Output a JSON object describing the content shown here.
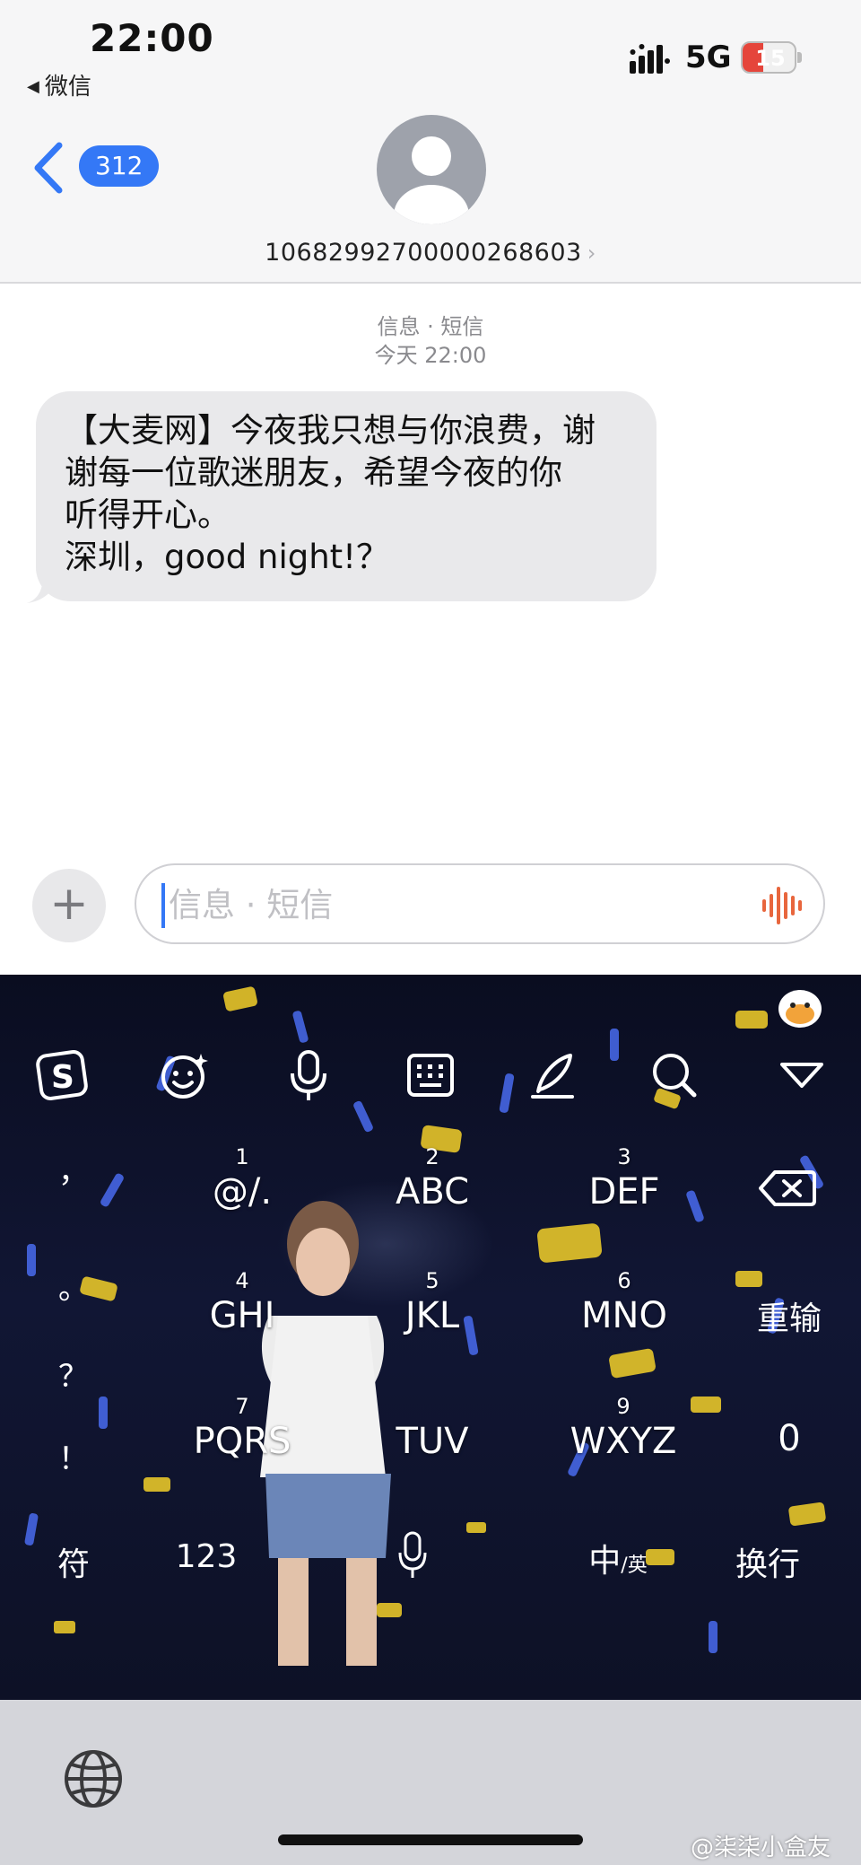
{
  "status_bar": {
    "time": "22:00",
    "back_app": "微信",
    "network": "5G",
    "battery": "15",
    "battery_level": 0.15
  },
  "header": {
    "unread_count": "312",
    "sender_number": "10682992700000268603",
    "chevron": "›"
  },
  "conversation": {
    "meta_line1": "信息 · 短信",
    "meta_line2": "今天 22:00",
    "message_lines": [
      "【大麦网】今夜我只想与你浪费，谢",
      "谢每一位歌迷朋友，希望今夜的你",
      "听得开心。",
      "深圳，good night!？"
    ]
  },
  "compose": {
    "add_label": "+",
    "placeholder": "信息 · 短信"
  },
  "keyboard": {
    "left_column": [
      "，",
      "。",
      "？",
      "！"
    ],
    "rows": [
      [
        {
          "num": "1",
          "label": "@/."
        },
        {
          "num": "2",
          "label": "ABC"
        },
        {
          "num": "3",
          "label": "DEF"
        }
      ],
      [
        {
          "num": "4",
          "label": "GHI"
        },
        {
          "num": "5",
          "label": "JKL"
        },
        {
          "num": "6",
          "label": "MNO"
        }
      ],
      [
        {
          "num": "7",
          "label": "PQRS"
        },
        {
          "num": "",
          "label": "TUV"
        },
        {
          "num": "9",
          "label": "WXYZ"
        }
      ]
    ],
    "right_keys": {
      "reinput": "重输",
      "zero": "0"
    },
    "bottom": {
      "symbols": "符",
      "numbers": "123",
      "chinese": "中",
      "english_sub": "/英",
      "newline": "换行"
    },
    "toolbar_icons": [
      "sogou-logo-icon",
      "emoji-icon",
      "microphone-icon",
      "keyboard-layout-icon",
      "handwriting-icon",
      "search-icon",
      "collapse-keyboard-icon"
    ]
  },
  "watermark": "@柒柒小盒友",
  "colors": {
    "accent_blue": "#3478f6",
    "bubble_gray": "#e9e9eb",
    "voice_orange": "#e8663d",
    "battery_red": "#e5453b"
  }
}
